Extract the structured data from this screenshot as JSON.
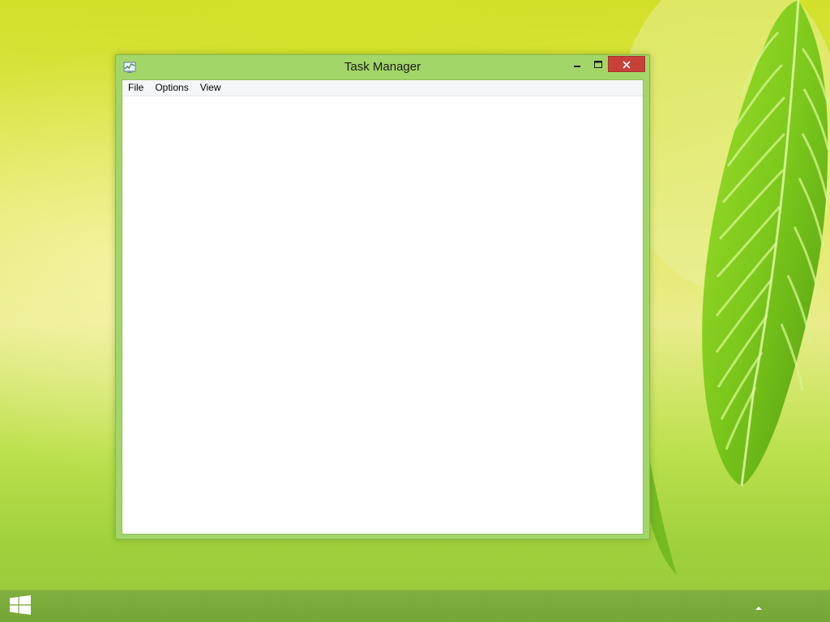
{
  "window": {
    "title": "Task Manager",
    "icon": "task-manager-icon",
    "controls": {
      "minimize": "minimize-icon",
      "maximize": "maximize-icon",
      "close": "close-icon"
    }
  },
  "menu": {
    "items": [
      {
        "label": "File"
      },
      {
        "label": "Options"
      },
      {
        "label": "View"
      }
    ]
  },
  "taskbar": {
    "start_icon": "windows-logo-icon",
    "tray_icon": "show-hidden-icons-arrow"
  },
  "colors": {
    "window_frame": "#a3d668",
    "close_button": "#c7403a",
    "taskbar": "#7aa93a",
    "desktop_accent": "#d2e02a"
  }
}
